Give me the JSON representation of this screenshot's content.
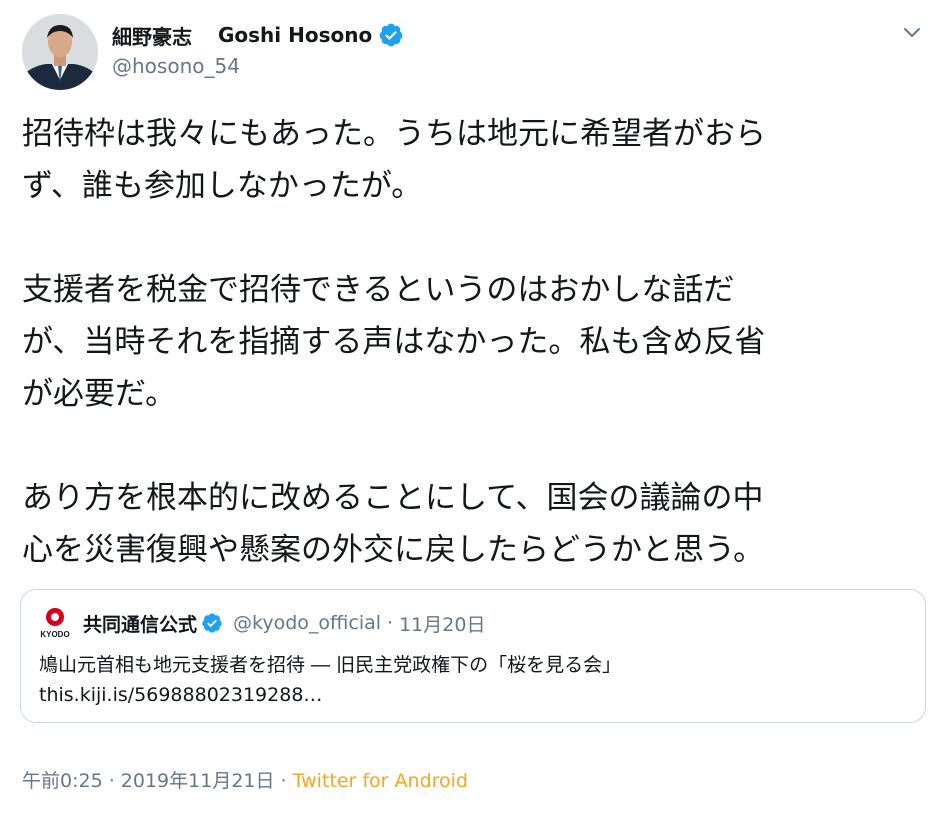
{
  "author": {
    "name_jp": "細野豪志",
    "name_en": "Goshi Hosono",
    "handle": "@hosono_54",
    "verified": true
  },
  "tweet": {
    "paragraphs": [
      [
        "招待枠は我々にもあった。うちは地元に希望者がおら",
        "ず、誰も参加しなかったが。"
      ],
      [
        "支援者を税金で招待できるというのはおかしな話だ",
        "が、当時それを指摘する声はなかった。私も含め反省",
        "が必要だ。"
      ],
      [
        "あり方を根本的に改めることにして、国会の議論の中",
        "心を災害復興や懸案の外交に戻したらどうかと思う。"
      ]
    ]
  },
  "quoted_tweet": {
    "name": "共同通信公式",
    "handle": "@kyodo_official",
    "separator": "·",
    "date": "11月20日",
    "line1": "鳩山元首相も地元支援者を招待 ― 旧民主党政権下の「桜を見る会」",
    "line2": "this.kiji.is/56988802319288…",
    "logo_text": "KYODO"
  },
  "footer": {
    "time": "午前0:25",
    "sep1": " · ",
    "date": "2019年11月21日",
    "sep2": " · ",
    "source": "Twitter for Android"
  },
  "colors": {
    "verified_blue": "#1da1f2",
    "secondary_text": "#657786",
    "source_link": "#f5a623",
    "kyodo_red": "#d7001a"
  },
  "icons": [
    "avatar",
    "verified-badge-icon",
    "chevron-down-icon",
    "kyodo-logo"
  ]
}
